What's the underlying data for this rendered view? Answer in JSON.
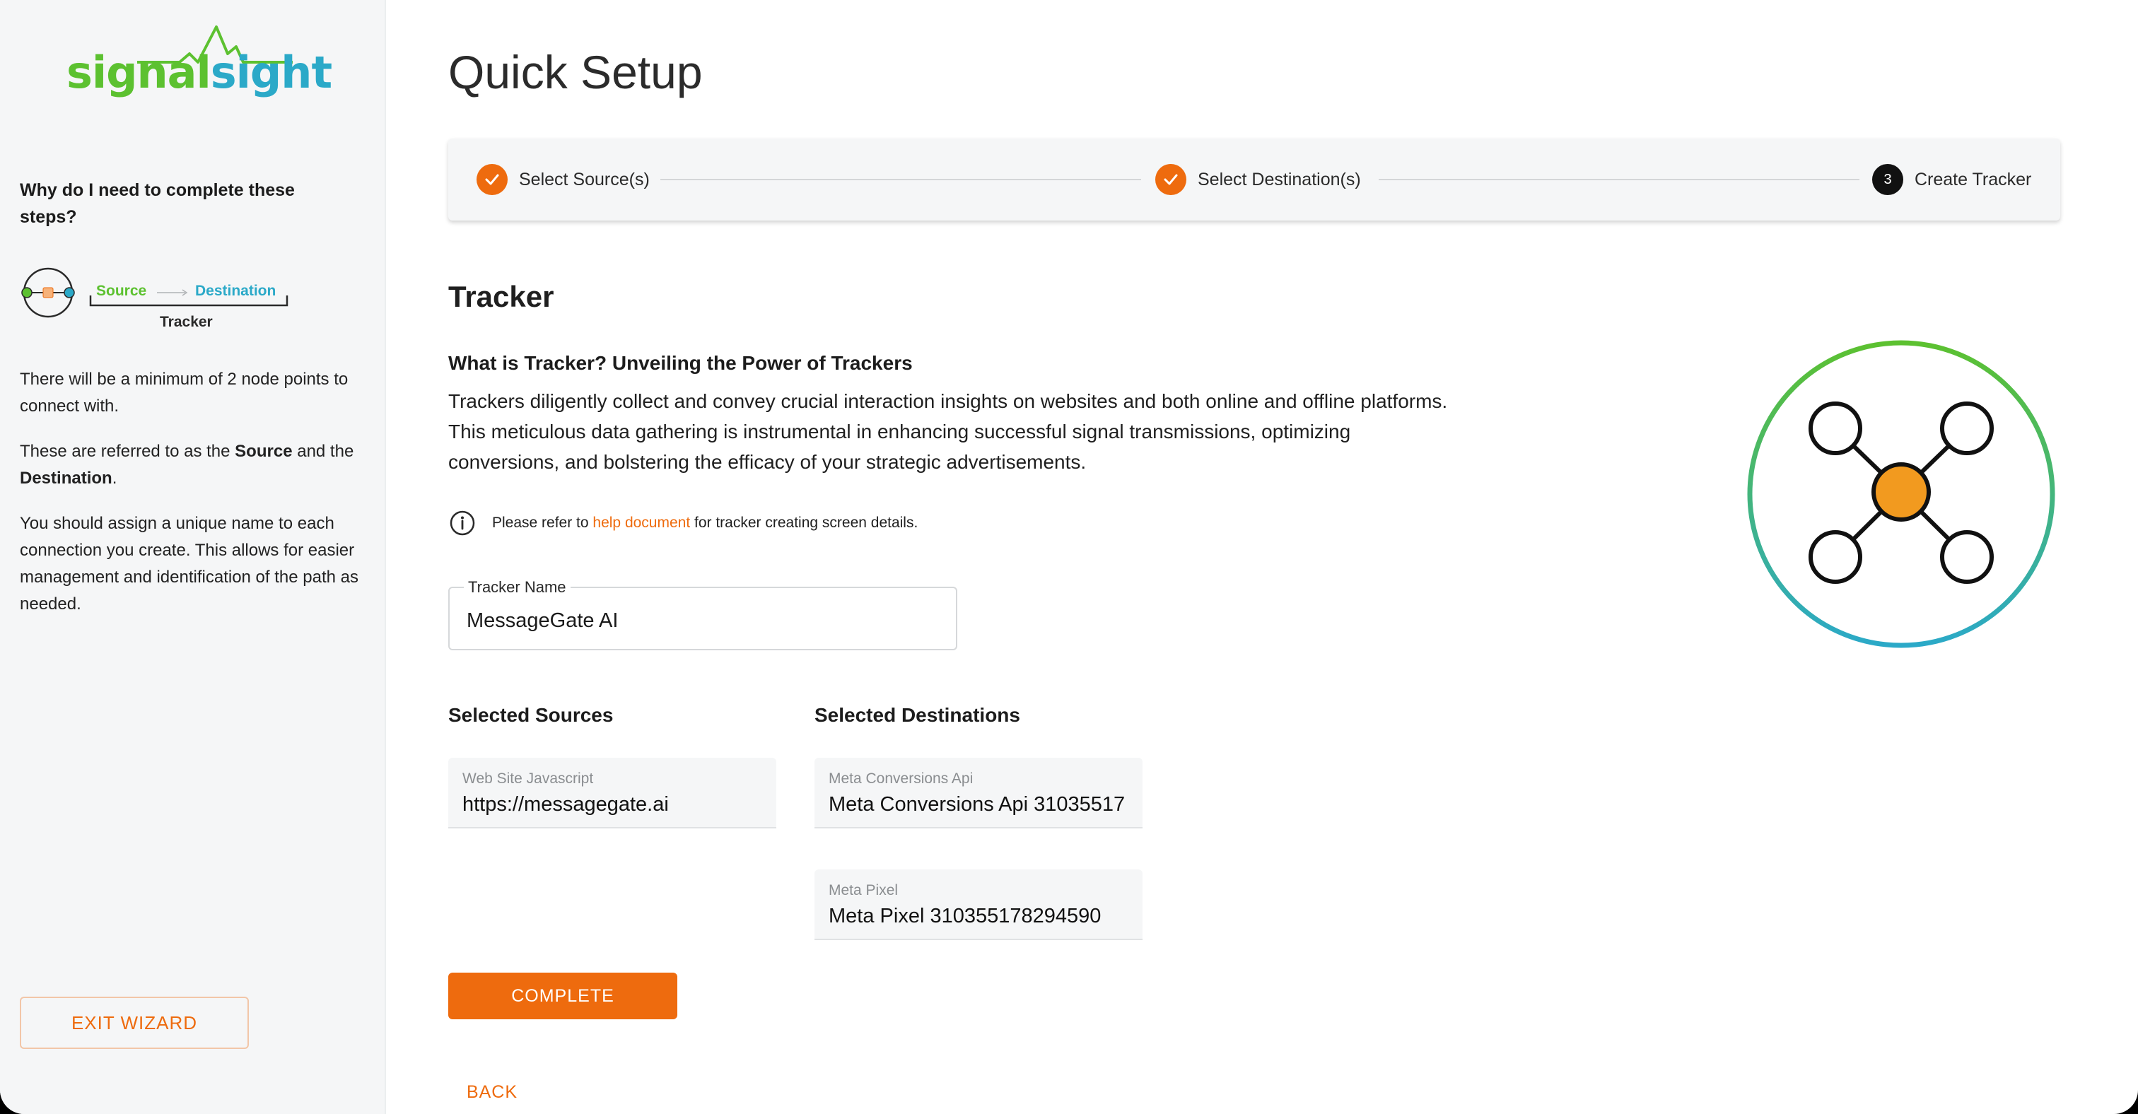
{
  "brand": {
    "logo_part1": "signal",
    "logo_part2": "sight",
    "color_green": "#5cc130",
    "color_blue": "#2ba9c8"
  },
  "sidebar": {
    "why_title": "Why do I need to complete these steps?",
    "diagram": {
      "source_label": "Source",
      "destination_label": "Destination",
      "tracker_label": "Tracker"
    },
    "para1": "There will be a minimum of 2 node points to connect with.",
    "para2_prefix": "These are referred to as the ",
    "para2_source": "Source",
    "para2_middle": " and the ",
    "para2_destination": "Destination",
    "para2_suffix": ".",
    "para3": "You should assign a unique name to each connection you create. This allows for easier management and identification of the path as needed.",
    "exit_label": "EXIT WIZARD"
  },
  "main": {
    "page_title": "Quick Setup",
    "stepper": {
      "steps": [
        {
          "label": "Select Source(s)",
          "status": "done"
        },
        {
          "label": "Select Destination(s)",
          "status": "done"
        },
        {
          "label": "Create Tracker",
          "status": "current",
          "number": "3"
        }
      ]
    },
    "section_title": "Tracker",
    "what_title": "What is Tracker? Unveiling the Power of Trackers",
    "what_body": "Trackers diligently collect and convey crucial interaction insights on websites and both online and offline platforms. This meticulous data gathering is instrumental in enhancing successful signal transmissions, optimizing conversions, and bolstering the efficacy of your strategic advertisements.",
    "info": {
      "prefix": "Please refer to ",
      "link": "help document",
      "suffix": " for tracker creating screen details."
    },
    "tracker_name": {
      "label": "Tracker Name",
      "value": "MessageGate AI"
    },
    "selected_sources": {
      "title": "Selected Sources",
      "items": [
        {
          "label": "Web Site Javascript",
          "value": "https://messagegate.ai"
        }
      ]
    },
    "selected_destinations": {
      "title": "Selected Destinations",
      "items": [
        {
          "label": "Meta Conversions Api",
          "value": "Meta Conversions Api 31035517"
        },
        {
          "label": "Meta Pixel",
          "value": "Meta Pixel 310355178294590"
        }
      ]
    },
    "complete_label": "COMPLETE",
    "back_label": "BACK",
    "accent_color": "#ee6b0e"
  }
}
